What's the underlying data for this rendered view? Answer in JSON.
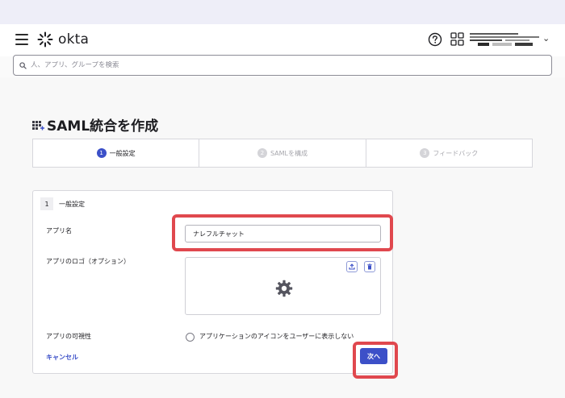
{
  "brand": {
    "name": "okta"
  },
  "search": {
    "placeholder": "人、アプリ、グループを検索"
  },
  "page": {
    "title": "SAML統合を作成"
  },
  "steps": [
    {
      "num": "1",
      "label": "一般設定",
      "active": true
    },
    {
      "num": "2",
      "label": "SAMLを構成",
      "active": false
    },
    {
      "num": "3",
      "label": "フィードバック",
      "active": false
    }
  ],
  "card": {
    "num": "1",
    "title": "一般設定",
    "app_name_label": "アプリ名",
    "app_name_value": "ナレフルチャット",
    "app_logo_label": "アプリのロゴ（オプション）",
    "visibility_label": "アプリの可視性",
    "visibility_option": "アプリケーションのアイコンをユーザーに表示しない",
    "cancel_label": "キャンセル",
    "next_label": "次へ"
  },
  "colors": {
    "accent": "#3c50c8",
    "highlight": "#e0484e"
  }
}
